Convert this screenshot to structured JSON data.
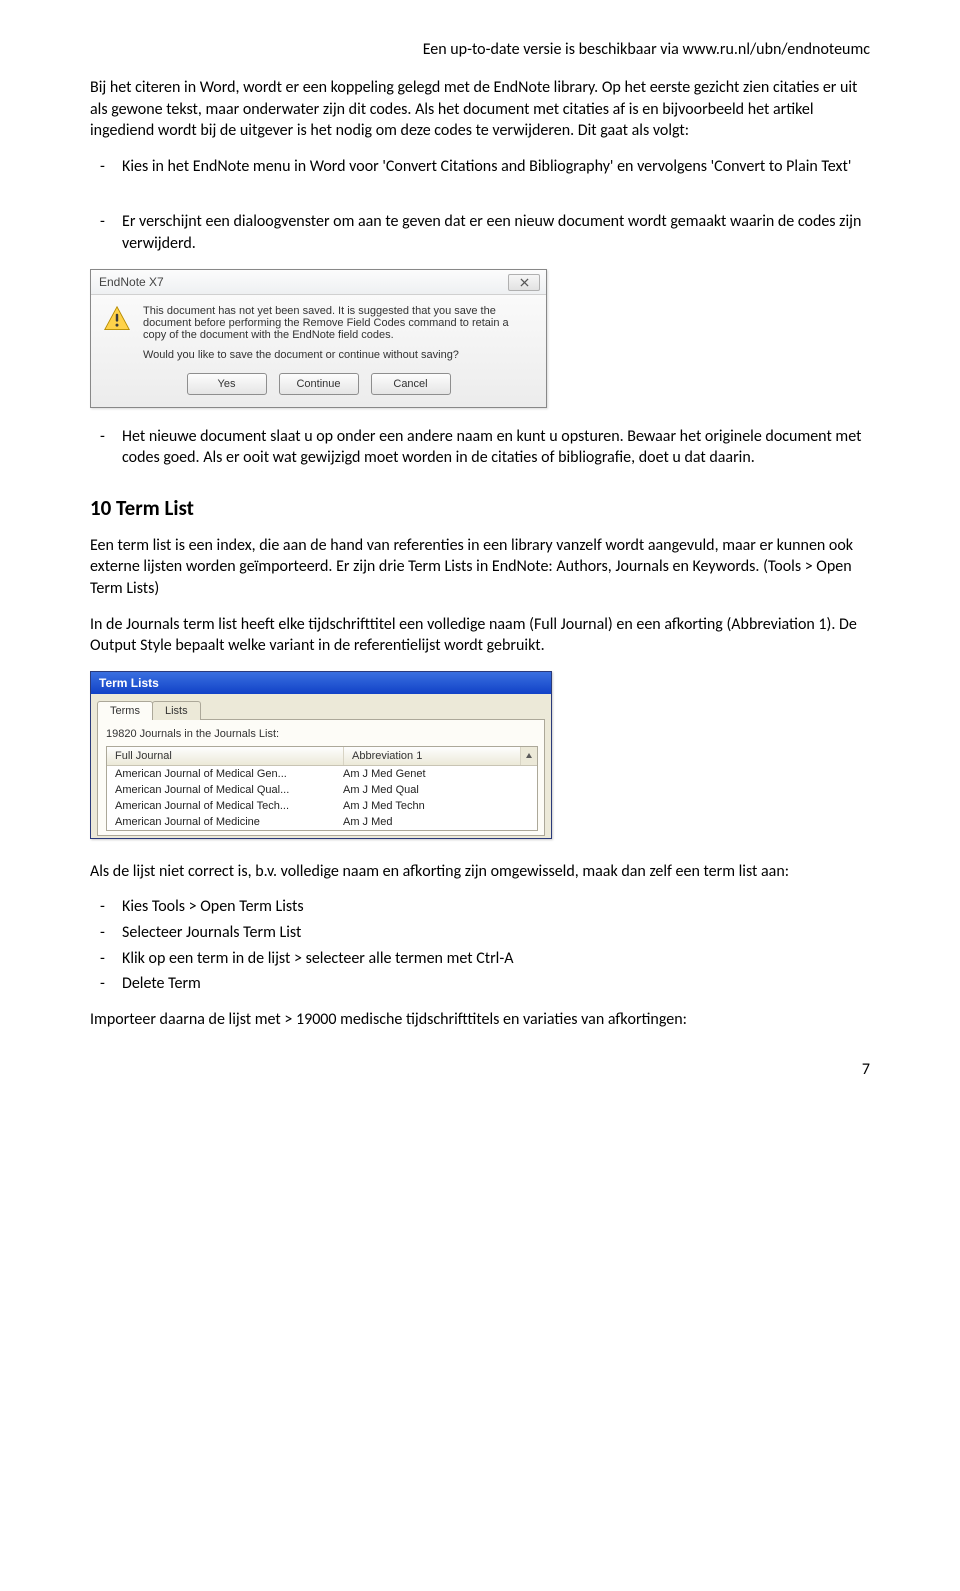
{
  "header_note": "Een up-to-date versie is beschikbaar via www.ru.nl/ubn/endnoteumc",
  "intro_p1": "Bij het citeren in Word, wordt er een koppeling gelegd met de EndNote library. Op het eerste gezicht zien citaties er uit als gewone tekst, maar onderwater zijn dit codes. Als het document met citaties af is en bijvoorbeeld het artikel ingediend wordt bij de uitgever is het nodig om deze codes te verwijderen. Dit gaat als volgt:",
  "bullet_kies": "Kies in het EndNote menu in Word voor 'Convert Citations and Bibliography' en vervolgens 'Convert to Plain Text'",
  "bullet_versch": "Er verschijnt een dialoogvenster om aan te geven dat er een nieuw document wordt gemaakt waarin de codes zijn verwijderd.",
  "dlg1": {
    "title": "EndNote X7",
    "msg": "This document has not yet been saved. It is suggested that you save the document before performing the Remove Field Codes command to retain a copy of the document with the EndNote field codes.",
    "question": "Would you like to save the document or continue without saving?",
    "btn_yes": "Yes",
    "btn_continue": "Continue",
    "btn_cancel": "Cancel"
  },
  "bullet_nieuw": "Het nieuwe document slaat u op onder een andere naam en kunt u opsturen. Bewaar het originele document met codes goed. Als er ooit wat gewijzigd moet worden in de citaties of bibliografie, doet u dat daarin.",
  "section_title": "10  Term List",
  "tl_p1": "Een term list is een index, die aan de hand van referenties in een library vanzelf wordt aangevuld, maar er kunnen ook externe lijsten worden geïmporteerd. Er zijn drie Term Lists in EndNote: Authors, Journals en Keywords. (Tools > Open Term Lists)",
  "tl_p2": "In de Journals term list heeft elke tijdschrifttitel een volledige naam (Full Journal) en een afkorting (Abbreviation 1). De Output Style bepaalt welke variant in de referentielijst wordt gebruikt.",
  "dlg2": {
    "title": "Term Lists",
    "tab_terms": "Terms",
    "tab_lists": "Lists",
    "count": "19820 Journals in the Journals List:",
    "col_full": "Full Journal",
    "col_abbrev": "Abbreviation 1",
    "rows": [
      {
        "full": "American Journal of Medical Gen...",
        "abbrev": "Am J Med Genet"
      },
      {
        "full": "American Journal of Medical Qual...",
        "abbrev": "Am J Med Qual"
      },
      {
        "full": "American Journal of Medical Tech...",
        "abbrev": "Am J Med Techn"
      },
      {
        "full": "American Journal of Medicine",
        "abbrev": "Am J Med"
      }
    ]
  },
  "after_tl": "Als  de lijst niet correct is, b.v.  volledige naam en afkorting zijn omgewisseld, maak dan zelf een term list aan:",
  "steps": {
    "s1": "Kies Tools > Open Term Lists",
    "s2": "Selecteer Journals Term List",
    "s3": "Klik op een term in de lijst > selecteer alle termen met Ctrl-A",
    "s4": "Delete Term"
  },
  "import_p": "Importeer daarna de lijst met  > 19000 medische tijdschrifttitels en variaties van afkortingen:",
  "pagenum": "7"
}
